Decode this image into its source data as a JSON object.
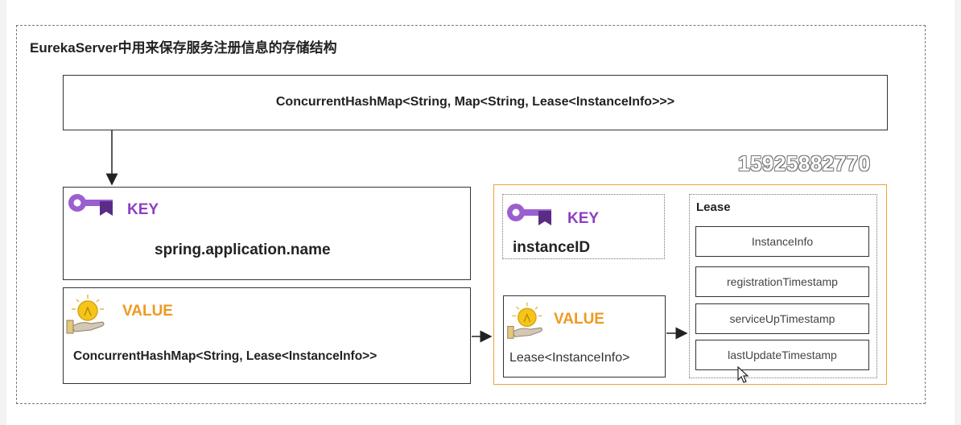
{
  "diagram": {
    "title": "EurekaServer中用来保存服务注册信息的存储结构",
    "root_map": "ConcurrentHashMap<String, Map<String, Lease<InstanceInfo>>>",
    "outer_key": {
      "label": "KEY",
      "value": "spring.application.name"
    },
    "outer_value": {
      "label": "VALUE",
      "value": "ConcurrentHashMap<String, Lease<InstanceInfo>>"
    },
    "inner_key": {
      "label": "KEY",
      "value": "instanceID"
    },
    "inner_value": {
      "label": "VALUE",
      "value": "Lease<InstanceInfo>"
    },
    "lease": {
      "title": "Lease",
      "fields": [
        "InstanceInfo",
        "registrationTimestamp",
        "serviceUpTimestamp",
        "lastUpdateTimestamp"
      ]
    },
    "watermark": "15925882770"
  },
  "colors": {
    "key": "#8b3fc2",
    "value": "#ee9a20",
    "inner_border": "#e8a33a"
  },
  "icons": [
    "key-icon",
    "lightbulb-hand-icon",
    "mouse-cursor-icon"
  ]
}
